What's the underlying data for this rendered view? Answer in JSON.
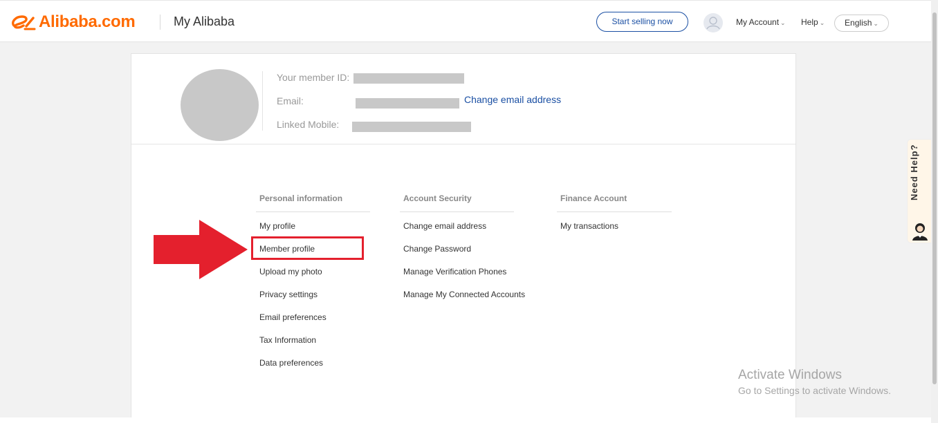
{
  "header": {
    "brand_text": "Alibaba.com",
    "section_title": "My Alibaba",
    "start_selling_label": "Start selling now",
    "my_account_label": "My Account",
    "help_label": "Help",
    "language_label": "English"
  },
  "profile": {
    "member_id_label": "Your member ID:",
    "email_label": "Email:",
    "change_email_link": "Change email address",
    "linked_mobile_label": "Linked Mobile:"
  },
  "columns": [
    {
      "heading": "Personal information",
      "items": [
        "My profile",
        "Member profile",
        "Upload my photo",
        "Privacy settings",
        "Email preferences",
        "Tax Information",
        "Data preferences"
      ]
    },
    {
      "heading": "Account Security",
      "items": [
        "Change email address",
        "Change Password",
        "Manage Verification Phones",
        "Manage My Connected Accounts"
      ]
    },
    {
      "heading": "Finance Account",
      "items": [
        "My transactions"
      ]
    }
  ],
  "need_help_label": "Need Help?",
  "watermark": {
    "title": "Activate Windows",
    "subtitle": "Go to Settings to activate Windows."
  },
  "colors": {
    "brand_orange": "#ff6a00",
    "link_blue": "#1a4fa3",
    "highlight_red": "#e4202d"
  }
}
